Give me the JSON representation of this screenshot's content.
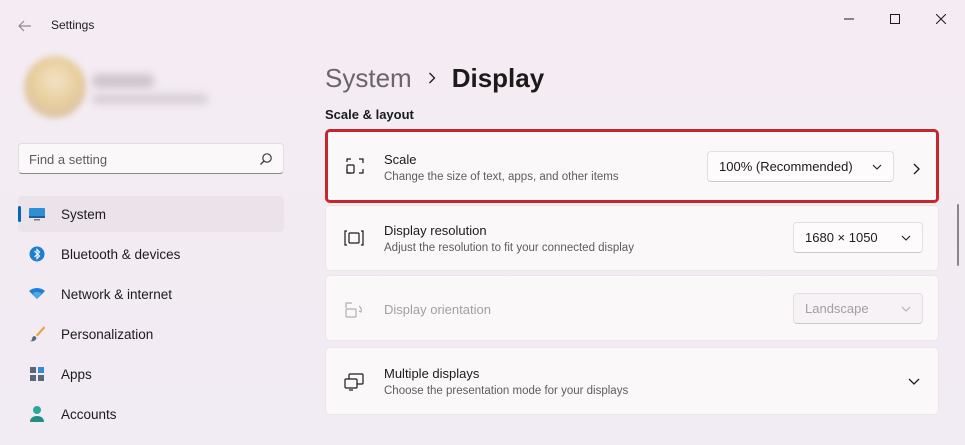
{
  "window": {
    "title": "Settings"
  },
  "sidebar": {
    "search_placeholder": "Find a setting",
    "items": [
      {
        "label": "System",
        "icon": "monitor-icon",
        "active": true
      },
      {
        "label": "Bluetooth & devices",
        "icon": "bluetooth-icon",
        "active": false
      },
      {
        "label": "Network & internet",
        "icon": "wifi-icon",
        "active": false
      },
      {
        "label": "Personalization",
        "icon": "brush-icon",
        "active": false
      },
      {
        "label": "Apps",
        "icon": "apps-icon",
        "active": false
      },
      {
        "label": "Accounts",
        "icon": "person-icon",
        "active": false
      }
    ]
  },
  "header": {
    "parent": "System",
    "current": "Display"
  },
  "section": {
    "title": "Scale & layout"
  },
  "cards": {
    "scale": {
      "title": "Scale",
      "desc": "Change the size of text, apps, and other items",
      "value": "100% (Recommended)"
    },
    "resolution": {
      "title": "Display resolution",
      "desc": "Adjust the resolution to fit your connected display",
      "value": "1680 × 1050"
    },
    "orientation": {
      "title": "Display orientation",
      "value": "Landscape",
      "disabled": true
    },
    "multiple": {
      "title": "Multiple displays",
      "desc": "Choose the presentation mode for your displays"
    }
  },
  "colors": {
    "accent": "#0067c0",
    "highlight": "#c4272e"
  }
}
